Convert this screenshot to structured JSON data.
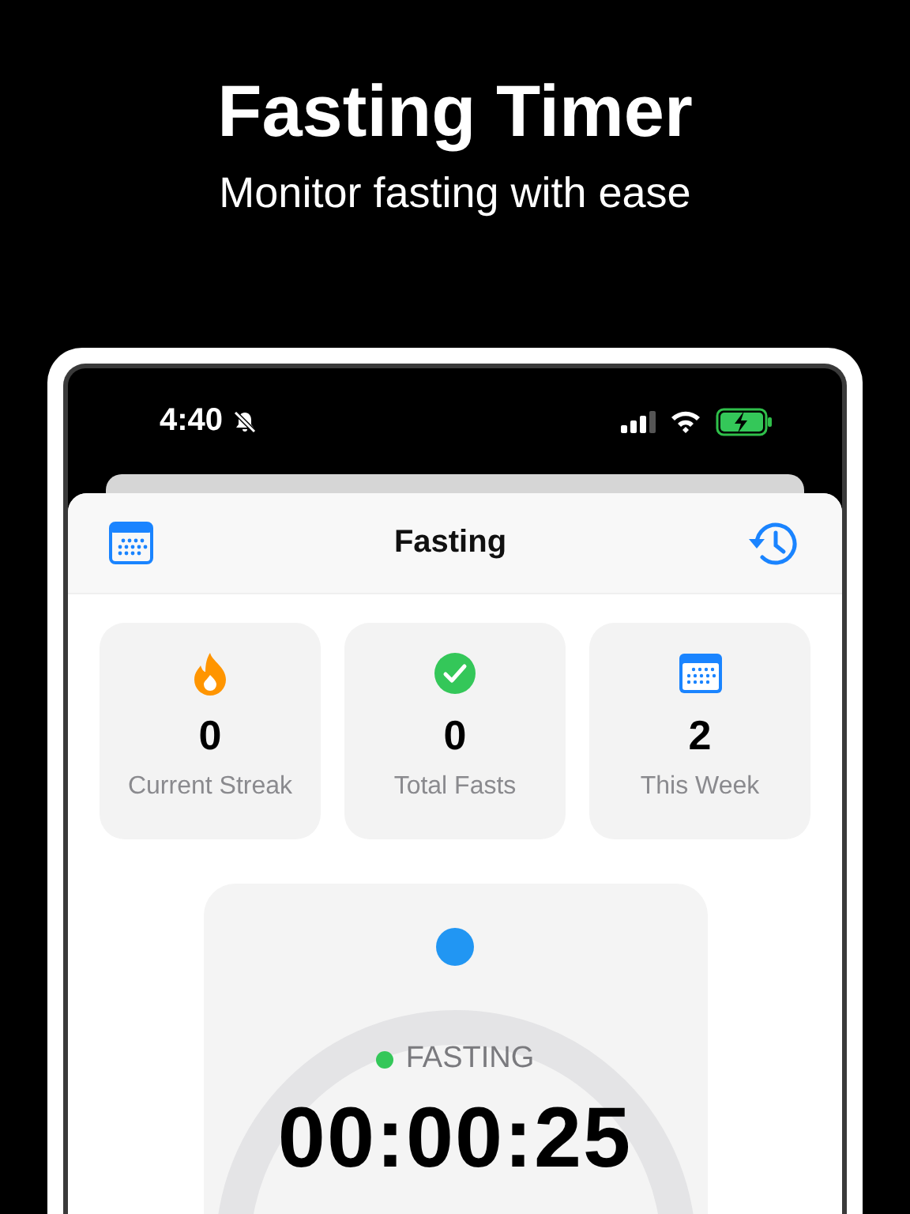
{
  "headline": "Fasting Timer",
  "subheadline": "Monitor fasting with ease",
  "status_bar": {
    "time": "4:40"
  },
  "nav": {
    "title": "Fasting"
  },
  "stats": [
    {
      "kind": "flame",
      "value": "0",
      "label": "Current Streak"
    },
    {
      "kind": "check",
      "value": "0",
      "label": "Total Fasts"
    },
    {
      "kind": "calendar",
      "value": "2",
      "label": "This Week"
    }
  ],
  "timer": {
    "status": "FASTING",
    "elapsed": "00:00:25"
  }
}
